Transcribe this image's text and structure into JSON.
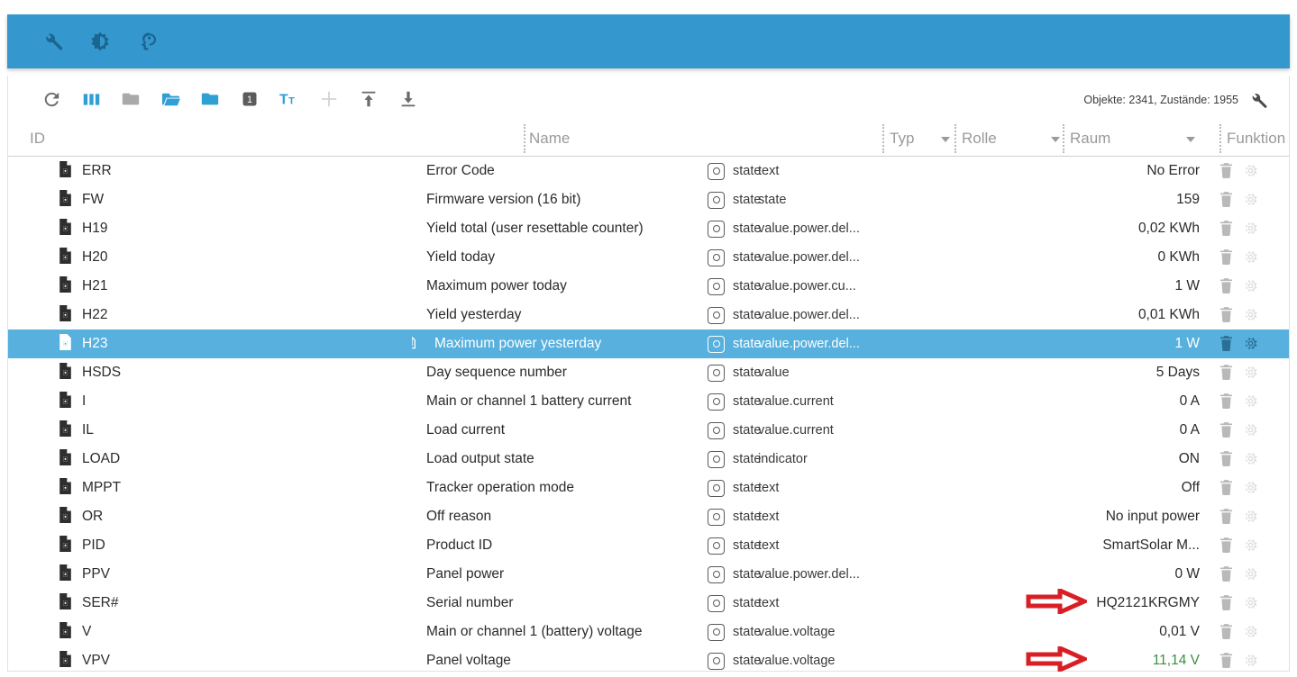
{
  "topbar": {
    "icons": [
      {
        "name": "wrench-icon",
        "label": "Einstellungen"
      },
      {
        "name": "brightness-icon",
        "label": "Helligkeit"
      },
      {
        "name": "expert-head-icon",
        "label": "Experte"
      }
    ]
  },
  "toolbar": {
    "buttons": [
      {
        "name": "refresh-icon",
        "label": "Aktualisieren"
      },
      {
        "name": "columns-icon",
        "label": "Spalten"
      },
      {
        "name": "folder-closed-icon",
        "label": "Alle schliessen"
      },
      {
        "name": "folder-open-icon",
        "label": "Alle oeffnen"
      },
      {
        "name": "folder-icon",
        "label": "Ordner"
      },
      {
        "name": "depth-1-badge-icon",
        "label": "1"
      },
      {
        "name": "text-format-icon",
        "label": "Tт"
      },
      {
        "name": "plus-icon",
        "label": "Hinzufuegen"
      },
      {
        "name": "export-upload-icon",
        "label": "Exportieren"
      },
      {
        "name": "import-download-icon",
        "label": "Importieren"
      }
    ],
    "depth_badge": "1",
    "text_format_label": "Tт",
    "status": "Objekte: 2341, Zustände: 1955",
    "settings_icon": "wrench-icon"
  },
  "columns": {
    "id": "ID",
    "name": "Name",
    "typ": "Typ",
    "rolle": "Rolle",
    "raum": "Raum",
    "funktion": "Funktion"
  },
  "colors": {
    "accent": "#3498ce",
    "selected_row": "#57b0dd",
    "annotation": "#d81f26",
    "value_green": "#3e8e41"
  },
  "rows": [
    {
      "id": "ERR",
      "name": "Error Code",
      "type": "state",
      "role": "text",
      "value": "No Error",
      "value_color": "dark",
      "selected": false,
      "copy": false,
      "arrow": false
    },
    {
      "id": "FW",
      "name": "Firmware version (16 bit)",
      "type": "state",
      "role": "state",
      "value": "159",
      "value_color": "dark",
      "selected": false,
      "copy": false,
      "arrow": false
    },
    {
      "id": "H19",
      "name": "Yield total (user resettable counter)",
      "type": "state",
      "role": "value.power.del...",
      "value": "0,02 KWh",
      "value_color": "dark",
      "selected": false,
      "copy": false,
      "arrow": false
    },
    {
      "id": "H20",
      "name": "Yield today",
      "type": "state",
      "role": "value.power.del...",
      "value": "0 KWh",
      "value_color": "dark",
      "selected": false,
      "copy": false,
      "arrow": false
    },
    {
      "id": "H21",
      "name": "Maximum power today",
      "type": "state",
      "role": "value.power.cu...",
      "value": "1 W",
      "value_color": "dark",
      "selected": false,
      "copy": false,
      "arrow": false
    },
    {
      "id": "H22",
      "name": "Yield yesterday",
      "type": "state",
      "role": "value.power.del...",
      "value": "0,01 KWh",
      "value_color": "dark",
      "selected": false,
      "copy": false,
      "arrow": false
    },
    {
      "id": "H23",
      "name": "Maximum power yesterday",
      "type": "state",
      "role": "value.power.del...",
      "value": "1 W",
      "value_color": "dark",
      "selected": true,
      "copy": true,
      "arrow": false
    },
    {
      "id": "HSDS",
      "name": "Day sequence number",
      "type": "state",
      "role": "value",
      "value": "5 Days",
      "value_color": "dark",
      "selected": false,
      "copy": false,
      "arrow": false
    },
    {
      "id": "I",
      "name": "Main or channel 1 battery current",
      "type": "state",
      "role": "value.current",
      "value": "0 A",
      "value_color": "dark",
      "selected": false,
      "copy": false,
      "arrow": false
    },
    {
      "id": "IL",
      "name": "Load current",
      "type": "state",
      "role": "value.current",
      "value": "0 A",
      "value_color": "dark",
      "selected": false,
      "copy": false,
      "arrow": false
    },
    {
      "id": "LOAD",
      "name": "Load output state",
      "type": "state",
      "role": "indicator",
      "value": "ON",
      "value_color": "dark",
      "selected": false,
      "copy": false,
      "arrow": false
    },
    {
      "id": "MPPT",
      "name": "Tracker operation mode",
      "type": "state",
      "role": "text",
      "value": "Off",
      "value_color": "dark",
      "selected": false,
      "copy": false,
      "arrow": false
    },
    {
      "id": "OR",
      "name": "Off reason",
      "type": "state",
      "role": "text",
      "value": "No input power",
      "value_color": "dark",
      "selected": false,
      "copy": false,
      "arrow": false
    },
    {
      "id": "PID",
      "name": "Product ID",
      "type": "state",
      "role": "text",
      "value": "SmartSolar M...",
      "value_color": "dark",
      "selected": false,
      "copy": false,
      "arrow": false
    },
    {
      "id": "PPV",
      "name": "Panel power",
      "type": "state",
      "role": "value.power.del...",
      "value": "0 W",
      "value_color": "dark",
      "selected": false,
      "copy": false,
      "arrow": false
    },
    {
      "id": "SER#",
      "name": "Serial number",
      "type": "state",
      "role": "text",
      "value": "HQ2121KRGMY",
      "value_color": "dark",
      "selected": false,
      "copy": false,
      "arrow": true
    },
    {
      "id": "V",
      "name": "Main or channel 1 (battery) voltage",
      "type": "state",
      "role": "value.voltage",
      "value": "0,01 V",
      "value_color": "dark",
      "selected": false,
      "copy": false,
      "arrow": false
    },
    {
      "id": "VPV",
      "name": "Panel voltage",
      "type": "state",
      "role": "value.voltage",
      "value": "11,14 V",
      "value_color": "green",
      "selected": false,
      "copy": false,
      "arrow": true
    }
  ],
  "row_actions": {
    "delete": "delete-icon",
    "settings": "gear-icon"
  }
}
